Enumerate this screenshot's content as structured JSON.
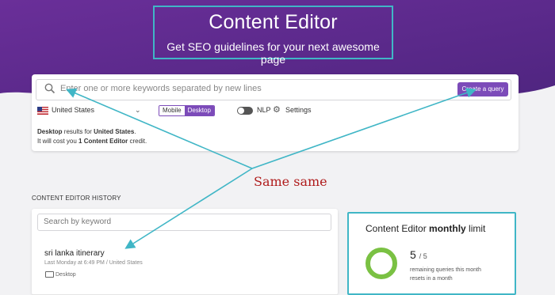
{
  "colors": {
    "hero_purple": "#5c2d8f",
    "accent_purple": "#7c4bb9",
    "annotation_teal": "#40b6c6",
    "annotation_red": "#b01c1c",
    "ring_green": "#7ac143"
  },
  "header": {
    "title": "Content Editor",
    "subtitle": "Get SEO guidelines for your next awesome page"
  },
  "query": {
    "placeholder": "Enter one or more keywords separated by new lines",
    "create_label": "Create a query",
    "country": "United States",
    "device_options": [
      "Mobile",
      "Desktop"
    ],
    "device_selected": "Desktop",
    "nlp_label": "NLP",
    "settings_label": "Settings",
    "info": {
      "device": "Desktop",
      "results_for": " results for ",
      "country": "United States",
      "period": ".",
      "cost_prefix": "It will cost you ",
      "cost_value": "1 Content Editor",
      "cost_suffix": " credit."
    }
  },
  "annotation": {
    "text": "Same same"
  },
  "history": {
    "title": "CONTENT EDITOR HISTORY",
    "search_placeholder": "Search by keyword",
    "items": [
      {
        "title": "sri lanka itinerary",
        "meta": "Last Monday at 6:49 PM / United States",
        "device": "Desktop"
      }
    ]
  },
  "limit": {
    "title_prefix": "Content Editor ",
    "title_bold": "monthly",
    "title_suffix": " limit",
    "remaining": "5",
    "total": "/ 5",
    "line1": "remaining queries this month",
    "line2": "resets in a month",
    "fraction_remaining": 1.0
  }
}
